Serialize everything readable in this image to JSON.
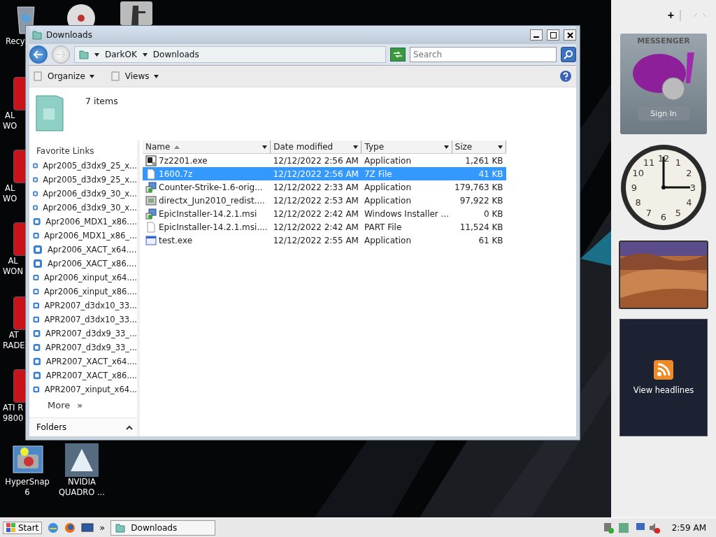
{
  "desktop_icons": [
    {
      "label": "Recy"
    },
    {
      "label": "AL\nWO"
    },
    {
      "label": "AL\nWO"
    },
    {
      "label": "AL\nWON"
    },
    {
      "label": "AT\nRADE"
    },
    {
      "label": "ATI R\n9800"
    }
  ],
  "desktop_bottom_icons": [
    {
      "label": "HyperSnap 6"
    },
    {
      "label": "NVIDIA\nQUADRO ..."
    }
  ],
  "window": {
    "title": "Downloads",
    "address": {
      "breadcrumbs": [
        "DarkOK",
        "Downloads"
      ],
      "search": {
        "placeholder": "Search"
      }
    },
    "toolbar": {
      "buttons": [
        "Organize",
        "Views"
      ]
    },
    "header": {
      "item_count": "7 items"
    },
    "nav": {
      "heading": "Favorite Links",
      "links": [
        "Apr2005_d3dx9_25_x...",
        "Apr2005_d3dx9_25_x...",
        "Apr2006_d3dx9_30_x...",
        "Apr2006_d3dx9_30_x...",
        "Apr2006_MDX1_x86....",
        "Apr2006_MDX1_x86_...",
        "Apr2006_XACT_x64....",
        "Apr2006_XACT_x86....",
        "Apr2006_xinput_x64....",
        "Apr2006_xinput_x86....",
        "APR2007_d3dx10_33...",
        "APR2007_d3dx10_33...",
        "APR2007_d3dx9_33_...",
        "APR2007_d3dx9_33_...",
        "APR2007_XACT_x64....",
        "APR2007_XACT_x86....",
        "APR2007_xinput_x64..."
      ],
      "more": "More",
      "more_arrow": "»",
      "folders": "Folders"
    },
    "table": {
      "columns": [
        "Name",
        "Date modified",
        "Type",
        "Size"
      ],
      "rows": [
        {
          "kind": "sevenzip",
          "name": "7z2201.exe",
          "date": "12/12/2022 2:56 AM",
          "type": "Application",
          "size": "1,261 KB",
          "selected": false
        },
        {
          "kind": "blank",
          "name": "1600.7z",
          "date": "12/12/2022 2:56 AM",
          "type": "7Z File",
          "size": "41 KB",
          "selected": true
        },
        {
          "kind": "installer",
          "name": "Counter-Strike-1.6-orig...",
          "date": "12/12/2022 2:33 AM",
          "type": "Application",
          "size": "179,763 KB",
          "selected": false
        },
        {
          "kind": "setup",
          "name": "directx_Jun2010_redist....",
          "date": "12/12/2022 2:53 AM",
          "type": "Application",
          "size": "97,922 KB",
          "selected": false
        },
        {
          "kind": "installer",
          "name": "EpicInstaller-14.2.1.msi",
          "date": "12/12/2022 2:42 AM",
          "type": "Windows Installer ...",
          "size": "0 KB",
          "selected": false
        },
        {
          "kind": "blank",
          "name": "EpicInstaller-14.2.1.msi....",
          "date": "12/12/2022 2:42 AM",
          "type": "PART File",
          "size": "11,524 KB",
          "selected": false
        },
        {
          "kind": "app",
          "name": "test.exe",
          "date": "12/12/2022 2:55 AM",
          "type": "Application",
          "size": "61 KB",
          "selected": false
        }
      ]
    }
  },
  "sidebar": {
    "add": "+",
    "messenger": {
      "title": "MESSENGER",
      "button": "Sign In"
    },
    "clock": {
      "numerals": [
        "12",
        "11",
        "1",
        "10",
        "2",
        "9",
        "3",
        "8",
        "4",
        "7",
        "5",
        "6"
      ]
    },
    "feeds": {
      "button": "View headlines"
    }
  },
  "taskbar": {
    "start": "Start",
    "chevron": "»",
    "tasks": [
      {
        "label": "Downloads",
        "selected": false
      }
    ],
    "clock": "2:59 AM"
  }
}
